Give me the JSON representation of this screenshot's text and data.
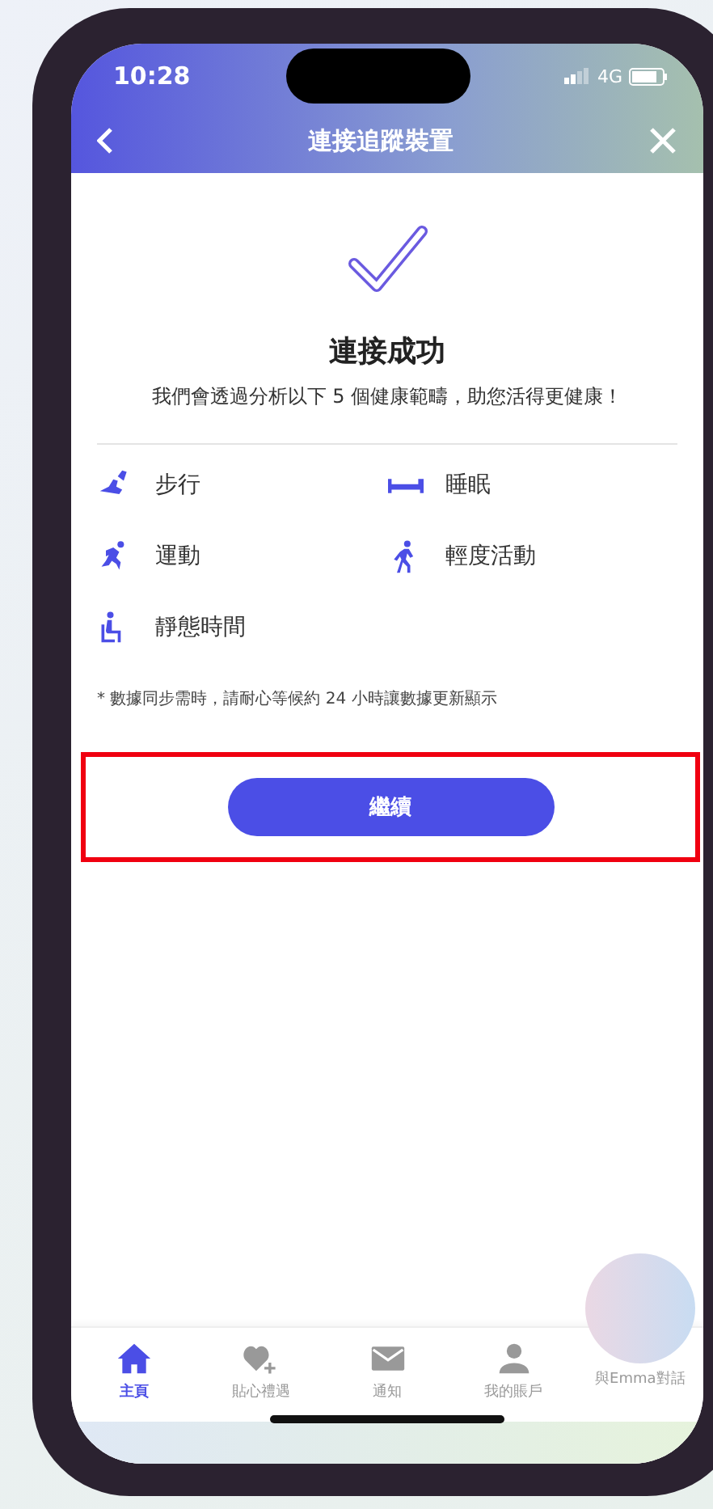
{
  "status_bar": {
    "time": "10:28",
    "network": "4G"
  },
  "header": {
    "title": "連接追蹤裝置"
  },
  "result": {
    "title": "連接成功",
    "message": "我們會透過分析以下 5 個健康範疇，助您活得更健康！"
  },
  "categories": [
    {
      "kind": "steps",
      "label": "步行"
    },
    {
      "kind": "sleep",
      "label": "睡眠"
    },
    {
      "kind": "exercise",
      "label": "運動"
    },
    {
      "kind": "light",
      "label": "輕度活動"
    },
    {
      "kind": "sedentary",
      "label": "靜態時間"
    }
  ],
  "note": "* 數據同步需時，請耐心等候約 24 小時讓數據更新顯示",
  "continue_button": "繼續",
  "tabs": [
    {
      "kind": "home",
      "label": "主頁",
      "selected": true
    },
    {
      "kind": "gift",
      "label": "貼心禮遇",
      "selected": false
    },
    {
      "kind": "mail",
      "label": "通知",
      "selected": false
    },
    {
      "kind": "account",
      "label": "我的賬戶",
      "selected": false
    },
    {
      "kind": "chat",
      "label": "與Emma對話",
      "selected": false
    }
  ]
}
